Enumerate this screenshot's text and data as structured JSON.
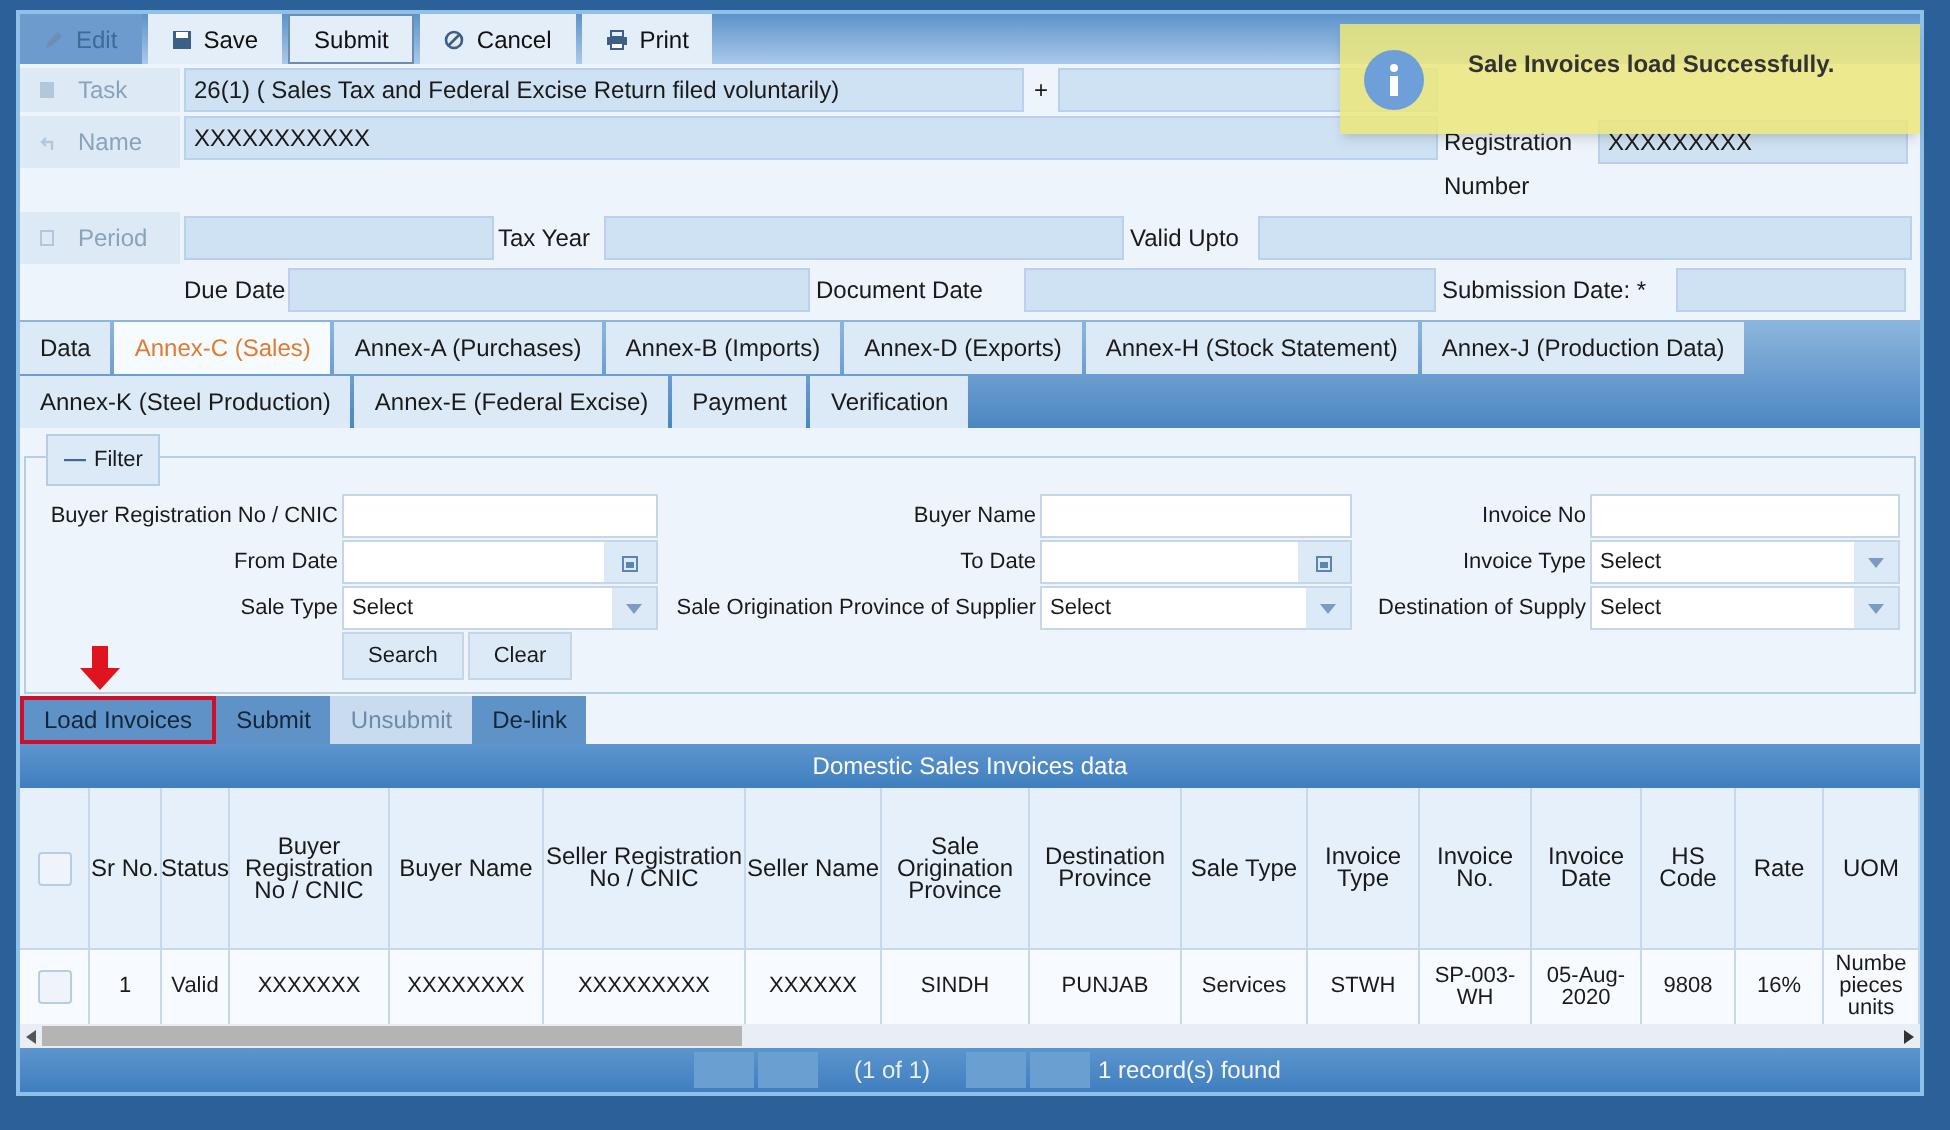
{
  "toolbar": [
    {
      "label": "Edit",
      "disabled": true,
      "pressed": false
    },
    {
      "label": "Save",
      "disabled": false,
      "pressed": false
    },
    {
      "label": "Submit",
      "disabled": false,
      "pressed": true
    },
    {
      "label": "Cancel",
      "disabled": false,
      "pressed": false
    },
    {
      "label": "Print",
      "disabled": false,
      "pressed": false
    }
  ],
  "header": {
    "task_label": "Task",
    "task": "26(1) ( Sales Tax and Federal Excise Return filed voluntarily)",
    "plus": "+",
    "name_label": "Name",
    "name": "XXXXXXXXXXX",
    "registration_label": "Registration Number",
    "registration": "XXXXXXXXX",
    "period_label": "Period",
    "tax_year_label": "Tax Year",
    "valid_upto_label": "Valid Upto",
    "due_date_label": "Due Date",
    "document_date_label": "Document Date",
    "submission_date_label": "Submission Date: *"
  },
  "tabs": [
    [
      {
        "label": "Data",
        "selected": false
      },
      {
        "label": "Annex-C (Sales)",
        "selected": true
      },
      {
        "label": "Annex-A (Purchases)",
        "selected": false
      },
      {
        "label": "Annex-B (Imports)",
        "selected": false
      },
      {
        "label": "Annex-D (Exports)",
        "selected": false
      },
      {
        "label": "Annex-H (Stock Statement)",
        "selected": false
      },
      {
        "label": "Annex-J (Production Data)",
        "selected": false
      }
    ],
    [
      {
        "label": "Annex-K (Steel Production)",
        "selected": false
      },
      {
        "label": "Annex-E (Federal Excise)",
        "selected": false
      },
      {
        "label": "Payment",
        "selected": false
      },
      {
        "label": "Verification",
        "selected": false
      }
    ]
  ],
  "filter": {
    "toggle": "—",
    "title": "Filter",
    "fields": [
      [
        {
          "label": "Buyer Registration No / CNIC",
          "kind": "text"
        },
        {
          "label": "Buyer Name",
          "kind": "text"
        },
        {
          "label": "Invoice No",
          "kind": "text"
        }
      ],
      [
        {
          "label": "From Date",
          "kind": "date"
        },
        {
          "label": "To Date",
          "kind": "date"
        },
        {
          "label": "Invoice Type",
          "kind": "select",
          "value": "Select"
        }
      ],
      [
        {
          "label": "Sale Type",
          "kind": "select",
          "value": "Select"
        },
        {
          "label": "Sale Origination Province of Supplier",
          "kind": "select",
          "value": "Select"
        },
        {
          "label": "Destination of Supply",
          "kind": "select",
          "value": "Select"
        }
      ]
    ],
    "buttons": [
      "Search",
      "Clear"
    ]
  },
  "actions": [
    {
      "label": "Load Invoices",
      "disabled": false,
      "highlighted": true
    },
    {
      "label": "Submit",
      "disabled": false,
      "highlighted": false
    },
    {
      "label": "Unsubmit",
      "disabled": true,
      "highlighted": false
    },
    {
      "label": "De-link",
      "disabled": false,
      "highlighted": false
    }
  ],
  "grid": {
    "title": "Domestic Sales Invoices data",
    "all_checked": false,
    "columns": [
      "Sr No.",
      "Status",
      "Buyer Registration No / CNIC",
      "Buyer Name",
      "Seller Registration No / CNIC",
      "Seller Name",
      "Sale Origination Province",
      "Destination Province",
      "Sale Type",
      "Invoice Type",
      "Invoice No.",
      "Invoice Date",
      "HS Code",
      "Rate",
      "UOM"
    ],
    "rows": [
      {
        "checked": false,
        "cells": [
          "1",
          "Valid",
          "XXXXXXX",
          "XXXXXXXX",
          "XXXXXXXXX",
          "XXXXXX",
          "SINDH",
          "PUNJAB",
          "Services",
          "STWH",
          "SP-003-WH",
          "05-Aug-2020",
          "9808",
          "16%",
          "Numbe pieces units"
        ]
      }
    ],
    "pager": "(1 of 1)",
    "records": "1 record(s) found"
  },
  "toast": {
    "message": "Sale Invoices load Successfully."
  }
}
